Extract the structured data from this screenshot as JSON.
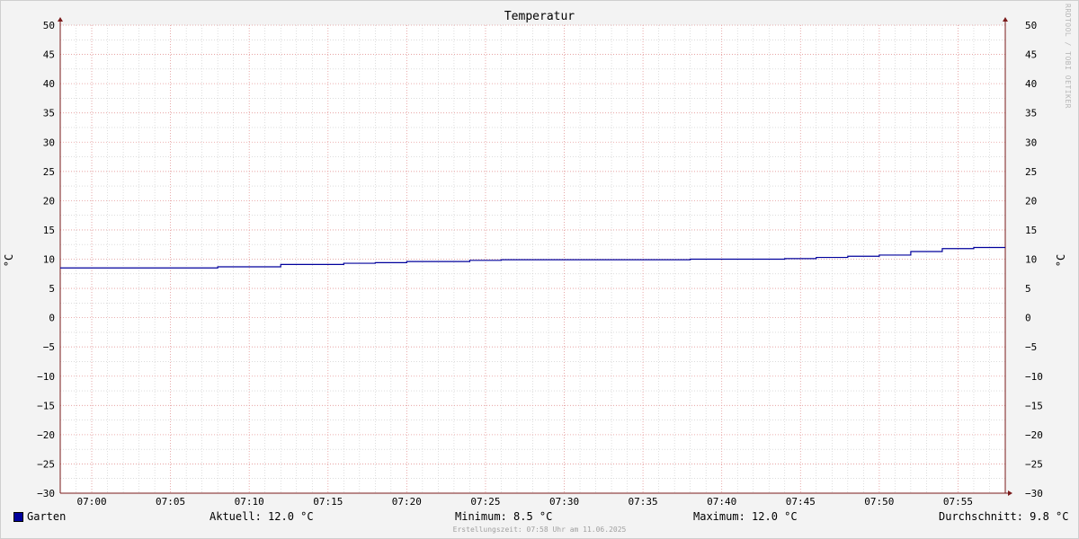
{
  "title": "Temperatur",
  "watermark": "RRDTOOL / TOBI OETIKER",
  "y_unit_left": "°C",
  "y_unit_right": "°C",
  "legend": {
    "series_name": "Garten",
    "current": "Aktuell: 12.0 °C",
    "minimum": "Minimum: 8.5 °C",
    "maximum": "Maximum: 12.0 °C",
    "average": "Durchschnitt: 9.8 °C"
  },
  "footer": "Erstellungszeit: 07:58 Uhr am 11.06.2025",
  "colors": {
    "series": "#00009c",
    "major_grid": "#e89a9a",
    "minor_grid": "#c8c8c8",
    "axis": "#7a1a1a",
    "canvas": "#ffffff",
    "background": "#f3f3f3"
  },
  "chart_data": {
    "type": "line",
    "step": true,
    "title": "Temperatur",
    "ylabel": "°C",
    "ylim": [
      -30,
      50
    ],
    "yticks": [
      50,
      45,
      40,
      35,
      30,
      25,
      20,
      15,
      10,
      5,
      0,
      -5,
      -10,
      -15,
      -20,
      -25,
      -30
    ],
    "xlim": [
      "06:58",
      "07:58"
    ],
    "xticks": [
      "07:00",
      "07:05",
      "07:10",
      "07:15",
      "07:20",
      "07:25",
      "07:30",
      "07:35",
      "07:40",
      "07:45",
      "07:50",
      "07:55"
    ],
    "grid": true,
    "series": [
      {
        "name": "Garten",
        "color": "#00009c",
        "x": [
          "06:58",
          "07:08",
          "07:12",
          "07:16",
          "07:18",
          "07:20",
          "07:24",
          "07:26",
          "07:38",
          "07:44",
          "07:46",
          "07:48",
          "07:50",
          "07:52",
          "07:54",
          "07:56",
          "07:58"
        ],
        "y": [
          8.5,
          8.7,
          9.1,
          9.3,
          9.4,
          9.6,
          9.8,
          9.9,
          10.0,
          10.1,
          10.3,
          10.5,
          10.7,
          11.3,
          11.8,
          12.0,
          12.0
        ]
      }
    ]
  }
}
